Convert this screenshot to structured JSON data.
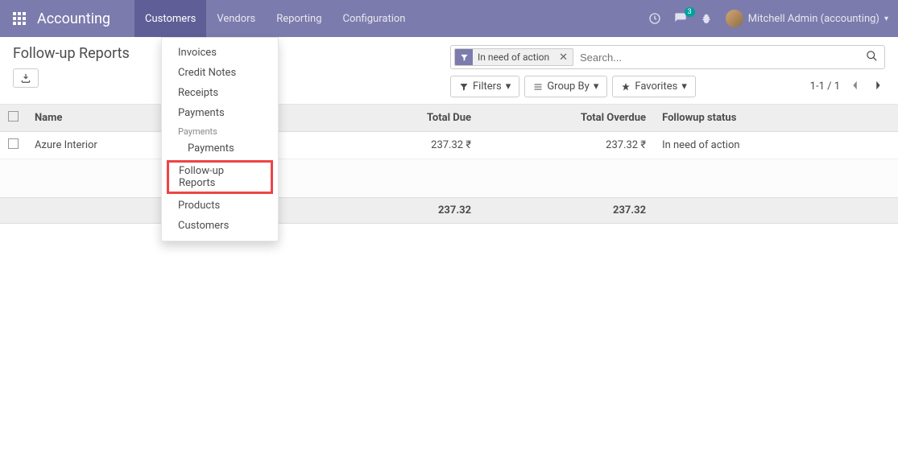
{
  "nav": {
    "brand": "Accounting",
    "items": [
      "Customers",
      "Vendors",
      "Reporting",
      "Configuration"
    ],
    "msg_badge": "3",
    "user": "Mitchell Admin (accounting)"
  },
  "dropdown": {
    "invoices": "Invoices",
    "credit_notes": "Credit Notes",
    "receipts": "Receipts",
    "payments": "Payments",
    "payments_header": "Payments",
    "payments_sub": "Payments",
    "followup": "Follow-up Reports",
    "products": "Products",
    "customers": "Customers"
  },
  "cp": {
    "title": "Follow-up Reports",
    "filter_tag": "In need of action",
    "search_placeholder": "Search...",
    "filters": "Filters",
    "groupby": "Group By",
    "favorites": "Favorites",
    "pager": "1-1 / 1"
  },
  "table": {
    "headers": {
      "name": "Name",
      "due": "Total Due",
      "overdue": "Total Overdue",
      "status": "Followup status"
    },
    "rows": [
      {
        "name": "Azure Interior",
        "due": "237.32 ₹",
        "overdue": "237.32 ₹",
        "status": "In need of action"
      }
    ],
    "totals": {
      "due": "237.32",
      "overdue": "237.32"
    }
  }
}
